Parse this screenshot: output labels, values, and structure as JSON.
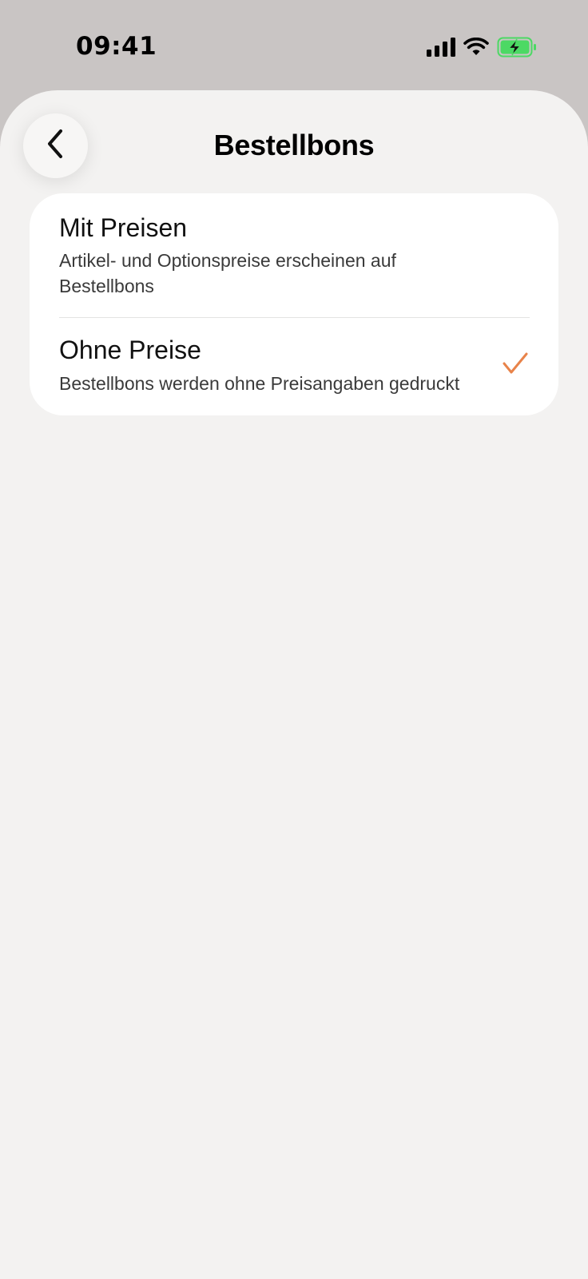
{
  "status_bar": {
    "time": "09:41",
    "icons": [
      "cellular-signal-icon",
      "wifi-icon",
      "battery-charging-icon"
    ],
    "battery_color": "#4cd964"
  },
  "header": {
    "title": "Bestellbons",
    "back_icon": "chevron-left-icon"
  },
  "options": [
    {
      "title": "Mit Preisen",
      "description": "Artikel- und Optionspreise erscheinen auf Bestellbons",
      "selected": false
    },
    {
      "title": "Ohne Preise",
      "description": "Bestellbons werden ohne Preisangaben gedruckt",
      "selected": true
    }
  ],
  "colors": {
    "accent": "#e8834a",
    "sheet_background": "#f3f2f1",
    "backdrop": "#c9c5c4"
  }
}
